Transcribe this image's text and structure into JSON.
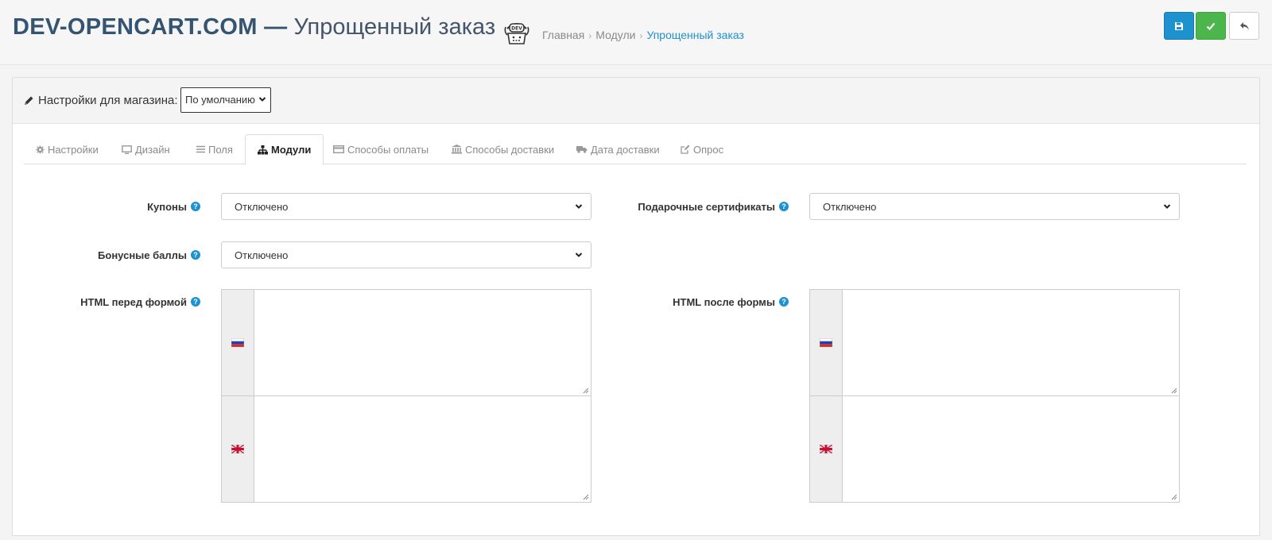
{
  "header": {
    "brand": "DEV-OPENCART.COM —",
    "subtitle": "Упрощенный заказ",
    "logo_icon": "dev-logo-icon",
    "breadcrumb": [
      {
        "label": "Главная"
      },
      {
        "label": "Модули"
      },
      {
        "label": "Упрощенный заказ"
      }
    ],
    "buttons": {
      "save_icon": "floppy-icon",
      "apply_icon": "check-icon",
      "back_icon": "reply-icon"
    },
    "colors": {
      "brand": "#355472",
      "save": "#1e91cf",
      "apply": "#4cb64c"
    }
  },
  "store": {
    "label": "Настройки для магазина:",
    "selected": "По умолчанию"
  },
  "tabs": [
    {
      "label": "Настройки",
      "icon": "gear-icon"
    },
    {
      "label": "Дизайн",
      "icon": "monitor-icon"
    },
    {
      "label": "Поля",
      "icon": "bars-icon"
    },
    {
      "label": "Модули",
      "icon": "sitemap-icon",
      "active": true
    },
    {
      "label": "Способы оплаты",
      "icon": "credit-card-icon"
    },
    {
      "label": "Способы доставки",
      "icon": "bank-icon"
    },
    {
      "label": "Дата доставки",
      "icon": "truck-icon"
    },
    {
      "label": "Опрос",
      "icon": "edit-icon"
    }
  ],
  "form": {
    "coupons": {
      "label": "Купоны",
      "value": "Отключено"
    },
    "vouchers": {
      "label": "Подарочные сертификаты",
      "value": "Отключено"
    },
    "reward": {
      "label": "Бонусные баллы",
      "value": "Отключено"
    },
    "html_before": {
      "label": "HTML перед формой",
      "languages": [
        "ru-flag-icon",
        "gb-flag-icon"
      ]
    },
    "html_after": {
      "label": "HTML после формы",
      "languages": [
        "ru-flag-icon",
        "gb-flag-icon"
      ]
    }
  }
}
